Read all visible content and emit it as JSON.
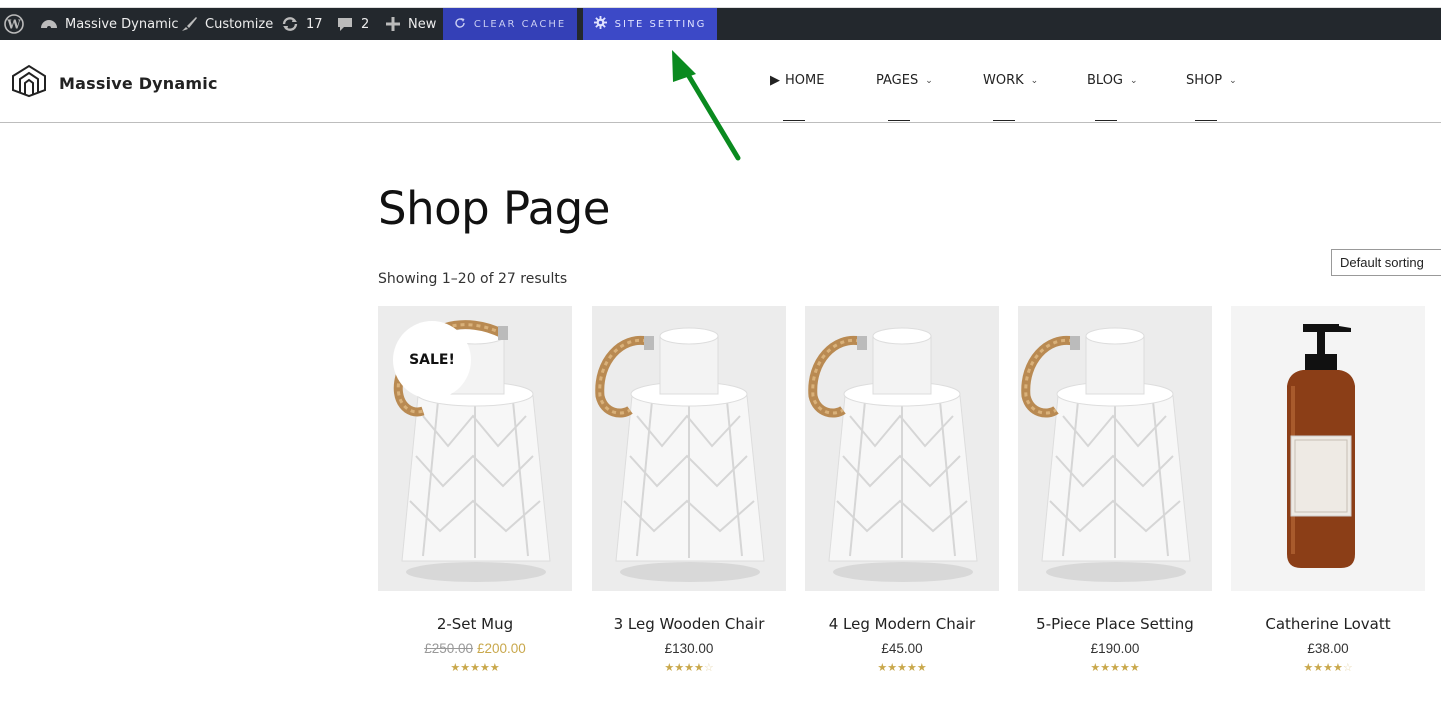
{
  "admin_bar": {
    "site_name": "Massive Dynamic",
    "customize": "Customize",
    "updates_count": "17",
    "comments_count": "2",
    "new_label": "New",
    "clear_cache": "CLEAR CACHE",
    "site_setting": "SITE SETTING"
  },
  "header": {
    "logo_text": "Massive Dynamic",
    "nav": [
      {
        "label": "HOME"
      },
      {
        "label": "PAGES"
      },
      {
        "label": "WORK"
      },
      {
        "label": "BLOG"
      },
      {
        "label": "SHOP"
      }
    ]
  },
  "page": {
    "title": "Shop Page",
    "results": "Showing 1–20 of 27 results",
    "sorting": "Default sorting"
  },
  "products": [
    {
      "name": "2-Set Mug",
      "old_price": "£250.00",
      "price": "£200.00",
      "sale_badge": "SALE!",
      "rating": 5,
      "image": "lantern-image"
    },
    {
      "name": "3 Leg Wooden Chair",
      "price": "£130.00",
      "rating": 4,
      "image": "lantern-image"
    },
    {
      "name": "4 Leg Modern Chair",
      "price": "£45.00",
      "rating": 5,
      "image": "lantern-image"
    },
    {
      "name": "5-Piece Place Setting",
      "price": "£190.00",
      "rating": 5,
      "image": "lantern-image"
    },
    {
      "name": "Catherine Lovatt",
      "price": "£38.00",
      "rating": 4,
      "image": "bottle-image"
    }
  ],
  "colors": {
    "admin_bar_bg": "#23282d",
    "admin_button_bg": "#3c49c7",
    "price_accent": "#c9a84c",
    "arrow": "#0a8a1f"
  }
}
